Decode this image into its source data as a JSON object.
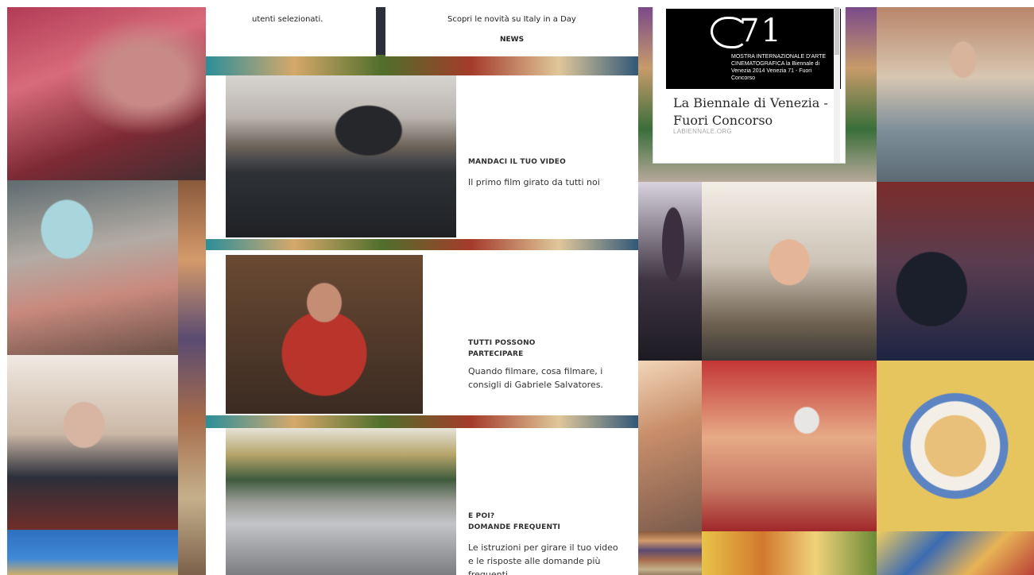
{
  "top_cards": {
    "left_text": "utenti selezionati.",
    "right_text": "Scopri le novità su Italy in a Day",
    "right_link": "NEWS"
  },
  "features": [
    {
      "title": "MANDACI IL TUO VIDEO",
      "desc": "Il primo film girato da tutti noi"
    },
    {
      "title": "TUTTI POSSONO PARTECIPARE",
      "desc": "Quando filmare, cosa filmare, i consigli di Gabriele Salvatores."
    },
    {
      "title_line1": "E POI?",
      "title_line2": "DOMANDE FREQUENTI",
      "desc": "Le istruzioni per girare il tuo video e le risposte alle domande più frequenti."
    }
  ],
  "venice_card": {
    "logo_number": "71",
    "logo_small": "MOSTRA INTERNAZIONALE D'ARTE CINEMATOGRAFICA la Biennale di Venezia 2014 Venezia 71 - Fuori Concorso",
    "headline": "La Biennale di Venezia - Fuori Concorso",
    "source": "LABIENNALE.ORG"
  },
  "photo_tiles": [
    "fabric-icon",
    "fish-market-icon",
    "woman-portrait-icon",
    "boat-icon",
    "black-dog-icon",
    "girl-eating-icon",
    "graduation-icon",
    "pasta-plate-icon",
    "santa-child-icon",
    "flowers-icon",
    "boy-bike-icon"
  ],
  "colors": {
    "panel": "#ffffff",
    "text": "#2f2f2f",
    "venice_logo_bg": "#000000"
  }
}
